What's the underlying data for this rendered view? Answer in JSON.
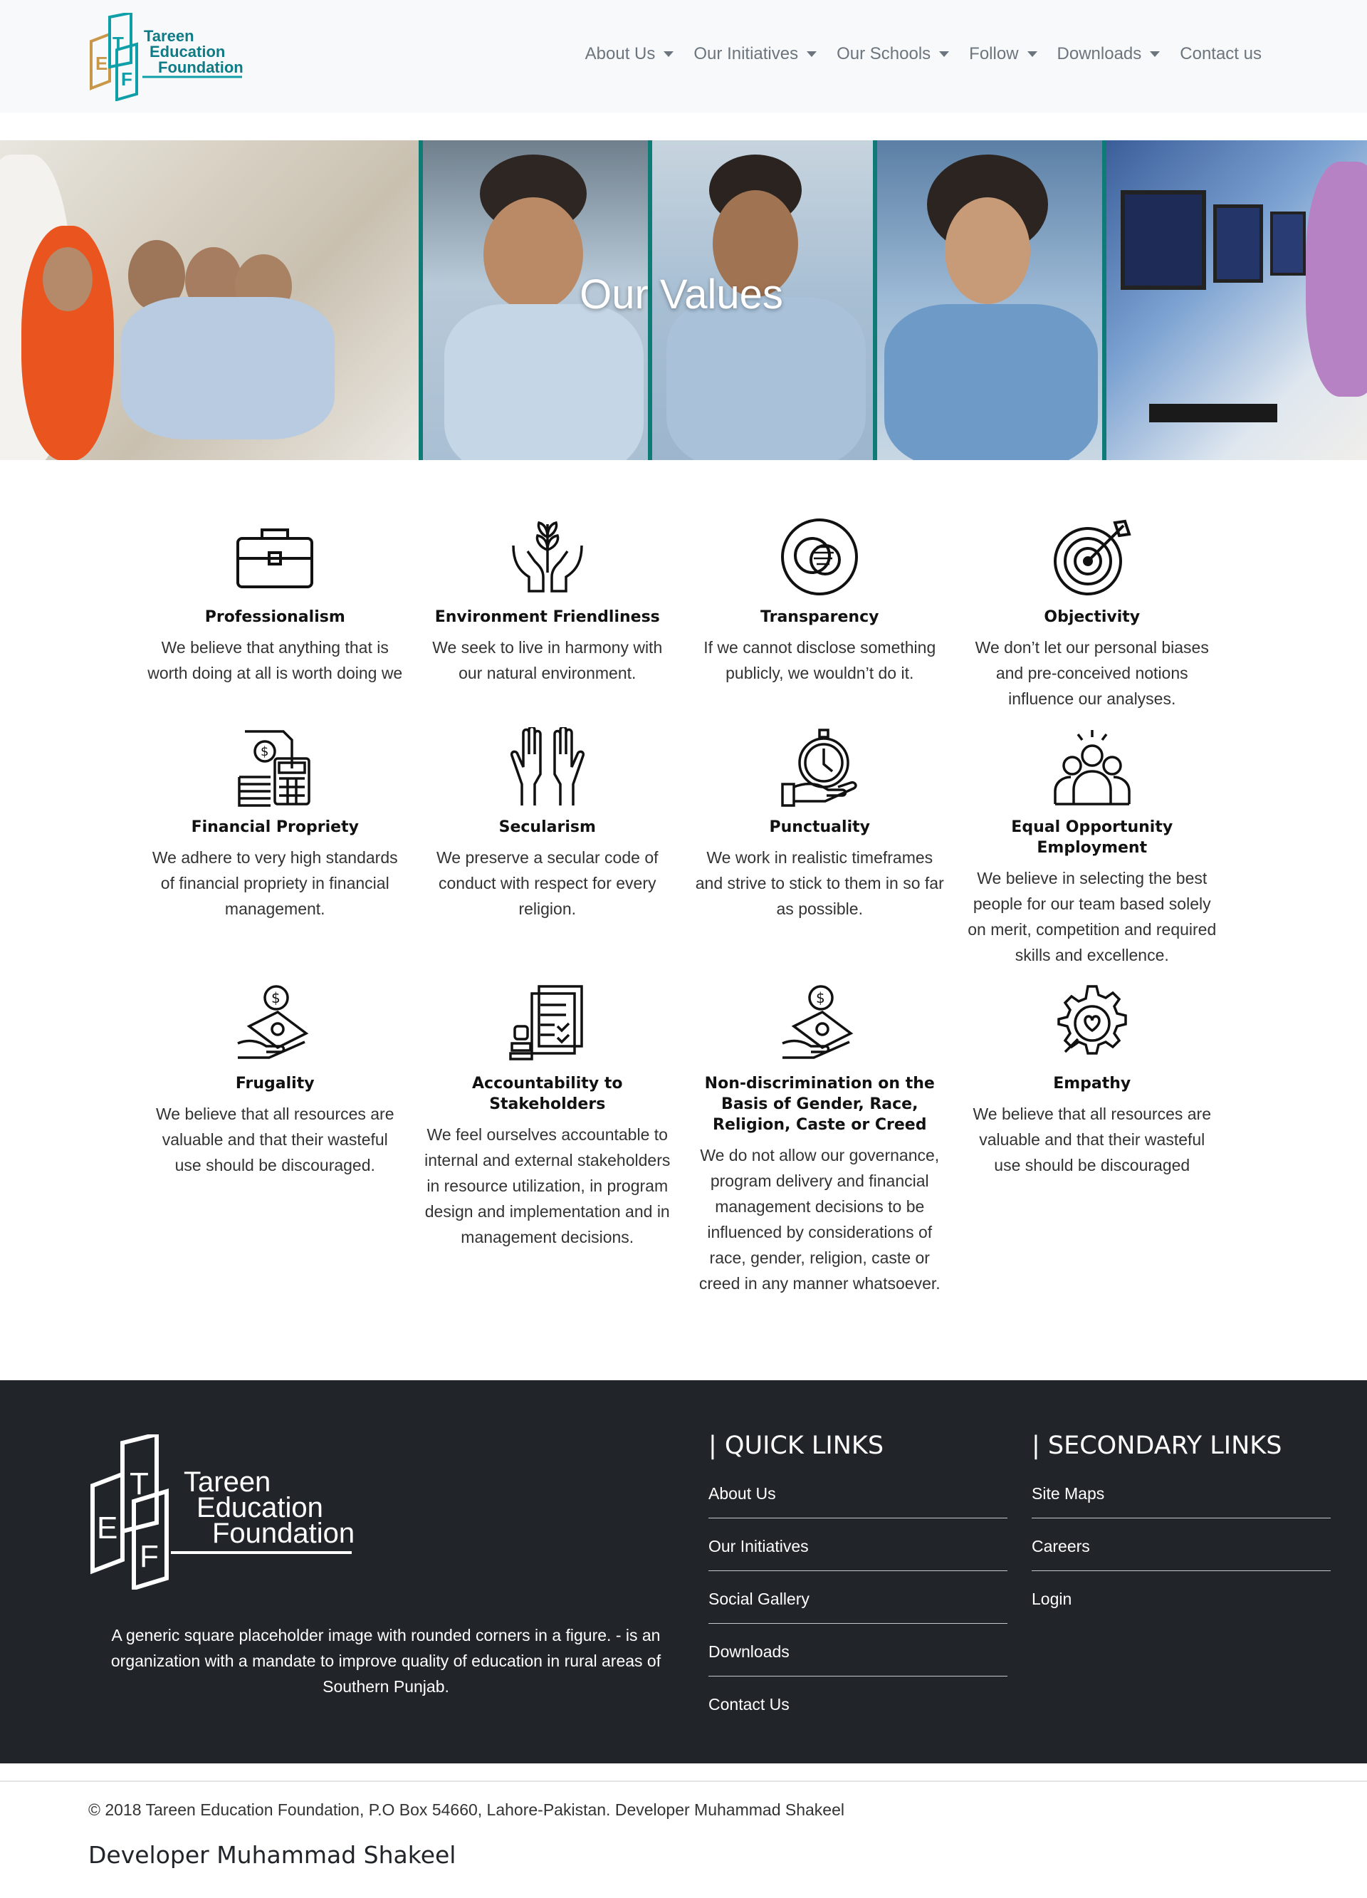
{
  "brand": {
    "logo_letters": [
      "T",
      "E",
      "F"
    ],
    "name_lines": [
      "Tareen",
      "Education",
      "Foundation"
    ]
  },
  "nav": [
    {
      "label": "About Us",
      "dropdown": true
    },
    {
      "label": "Our Initiatives",
      "dropdown": true
    },
    {
      "label": "Our Schools",
      "dropdown": true
    },
    {
      "label": "Follow",
      "dropdown": true
    },
    {
      "label": "Downloads",
      "dropdown": true
    },
    {
      "label": "Contact us",
      "dropdown": false
    }
  ],
  "hero": {
    "title": "Our Values"
  },
  "values": [
    {
      "icon": "briefcase-icon",
      "title": "Professionalism",
      "text": "We believe that anything that is worth doing at all is worth doing we"
    },
    {
      "icon": "plant-hands-icon",
      "title": "Environment Friendliness",
      "text": "We seek to live in harmony with our natural environment."
    },
    {
      "icon": "transparency-icon",
      "title": "Transparency",
      "text": "If we cannot disclose something publicly, we wouldn’t do it."
    },
    {
      "icon": "target-icon",
      "title": "Objectivity",
      "text": "We don’t let our personal biases and pre-conceived notions influence our analyses."
    },
    {
      "icon": "finance-icon",
      "title": "Financial Propriety",
      "text": "We adhere to very high standards of financial propriety in financial management."
    },
    {
      "icon": "raised-hands-icon",
      "title": "Secularism",
      "text": "We preserve a secular code of conduct with respect for every religion."
    },
    {
      "icon": "stopwatch-hand-icon",
      "title": "Punctuality",
      "text": "We work in realistic timeframes and strive to stick to them in so far as possible."
    },
    {
      "icon": "team-icon",
      "title": "Equal Opportunity Employment",
      "text": "We believe in selecting the best people for our team based solely on merit, competition and required skills and excellence."
    },
    {
      "icon": "money-hand-icon",
      "title": "Frugality",
      "text": "We believe that all resources are valuable and that their wasteful use should be discouraged."
    },
    {
      "icon": "documents-stamp-icon",
      "title": "Accountability to Stakeholders",
      "text": "We feel ourselves accountable to internal and external stakeholders in resource utilization, in program design and implementation and in management decisions."
    },
    {
      "icon": "money-hand-icon",
      "title": "Non-discrimination on the Basis of Gender, Race, Religion, Caste or Creed",
      "text": "We do not allow our governance, program delivery and financial management decisions to be influenced by considerations of race, gender, religion, caste or creed in any manner whatsoever."
    },
    {
      "icon": "gear-heart-icon",
      "title": "Empathy",
      "text": "We believe that all resources are valuable and that their wasteful use should be discouraged"
    }
  ],
  "footer": {
    "description": "A generic square placeholder image with rounded corners in a figure. - is an organization with a mandate to improve quality of education in rural areas of Southern Punjab.",
    "quick_links_title": "| QUICK LINKS",
    "quick_links": [
      "About Us",
      "Our Initiatives",
      "Social Gallery",
      "Downloads",
      "Contact Us"
    ],
    "secondary_links_title": "| SECONDARY LINKS",
    "secondary_links": [
      "Site Maps",
      "Careers",
      "Login"
    ]
  },
  "bottom": {
    "copyright": "© 2018 Tareen Education Foundation, P.O Box 54660, Lahore-Pakistan. Developer Muhammad Shakeel",
    "developer": "Developer Muhammad Shakeel"
  },
  "colors": {
    "brand_teal": "#0f9fa8",
    "brand_gold": "#c9974a",
    "footer_bg": "#212529",
    "navbar_bg": "#f8f9fa"
  }
}
